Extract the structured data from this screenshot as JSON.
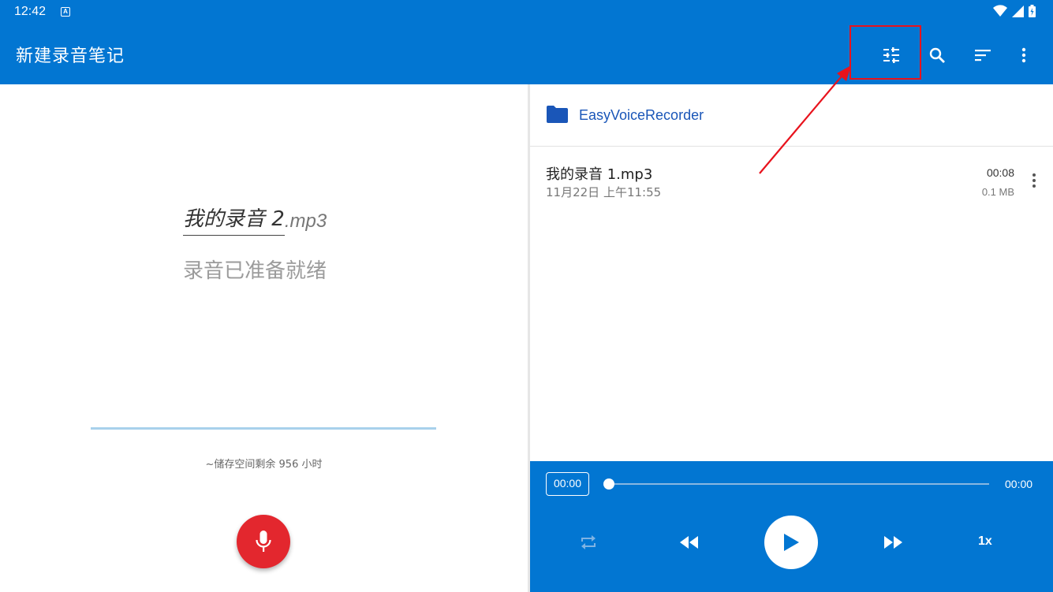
{
  "status_bar": {
    "time": "12:42",
    "notification_icon": "a-letter-icon",
    "icons": [
      "wifi-icon",
      "signal-icon",
      "battery-icon"
    ]
  },
  "app_bar": {
    "title": "新建录音笔记",
    "actions": [
      "tune-icon",
      "search-icon",
      "sort-icon",
      "more-vert-icon"
    ]
  },
  "recorder": {
    "filename": "我的录音 2",
    "extension": ".mp3",
    "status": "录音已准备就绪",
    "storage": "~储存空间剩余 956 小时",
    "record_button_icon": "mic-icon"
  },
  "folder": {
    "icon": "folder-icon",
    "name": "EasyVoiceRecorder"
  },
  "recordings": [
    {
      "name": "我的录音 1.mp3",
      "date": "11月22日 上午11:55",
      "duration": "00:08",
      "size": "0.1 MB"
    }
  ],
  "player": {
    "current_time": "00:00",
    "total_time": "00:00",
    "progress": 0,
    "speed": "1x",
    "controls": [
      "repeat-icon",
      "rewind-icon",
      "play-icon",
      "fast-forward-icon"
    ]
  },
  "colors": {
    "primary": "#0276d2",
    "record": "#e3272e",
    "annotation": "#e8131d",
    "folder": "#1a56b8"
  }
}
